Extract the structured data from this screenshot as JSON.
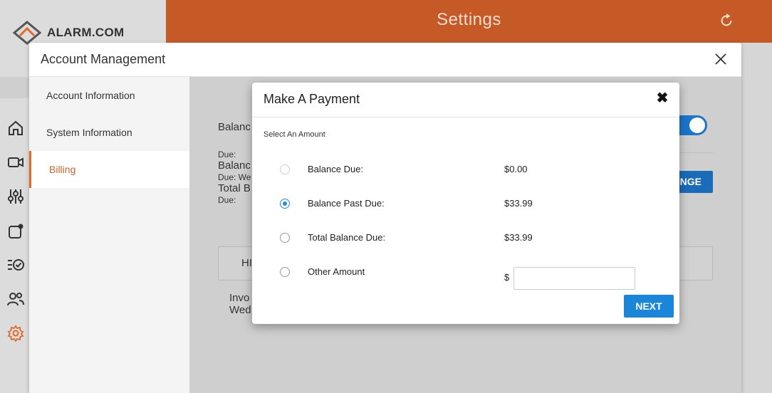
{
  "app": {
    "title": "Settings",
    "logo": "ALARM.COM",
    "icons": [
      "refresh-icon",
      "help-icon",
      "home-icon",
      "video-icon",
      "sliders-icon",
      "notification-icon",
      "checklist-icon",
      "users-icon",
      "gear-icon"
    ]
  },
  "account_management": {
    "title": "Account Management",
    "sidebar": [
      {
        "label": "Account Information"
      },
      {
        "label": "System Information"
      },
      {
        "label": "Billing",
        "active": true
      }
    ],
    "background_fragments": {
      "balance_heading": "Balanc",
      "due_1": "Due:",
      "balance_2": "Balanc",
      "due_we": "Due: We",
      "total_b": "Total B",
      "due_2": "Due:",
      "change_button": "NGE",
      "hi": "HI",
      "invo": "Invo",
      "wed": "Wed"
    }
  },
  "modal": {
    "title": "Make A Payment",
    "close_symbol": "✖",
    "section_label": "Select An Amount",
    "options": [
      {
        "label": "Balance Due:",
        "amount": "$0.00",
        "selected": false
      },
      {
        "label": "Balance Past Due:",
        "amount": "$33.99",
        "selected": true
      },
      {
        "label": "Total Balance Due:",
        "amount": "$33.99",
        "selected": false
      },
      {
        "label": "Other Amount",
        "amount": "",
        "selected": false
      }
    ],
    "currency_symbol": "$",
    "other_amount_value": "",
    "next_label": "NEXT"
  },
  "colors": {
    "brand_orange": "#c65a26",
    "accent_blue": "#1a86d9",
    "active_nav": "#d06427"
  }
}
